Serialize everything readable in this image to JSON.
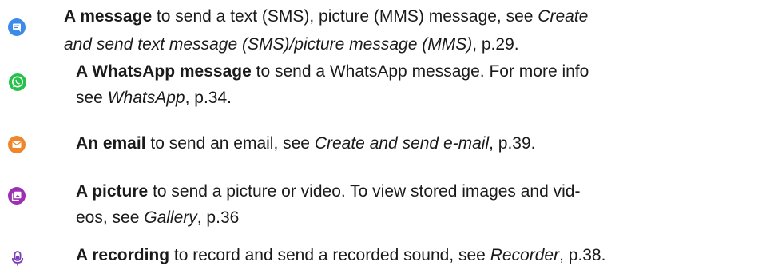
{
  "items": [
    {
      "icon": "message-icon",
      "icon_color": "#3d8be8",
      "title": "A message",
      "line1_rest": " to send a text (SMS), picture (MMS) message, see ",
      "line1_link": "Create",
      "line2_link": "and send text message (SMS)/picture message (MMS)",
      "line2_tail": ", p.29."
    },
    {
      "icon": "whatsapp-icon",
      "icon_color": "#27c04b",
      "title": "A WhatsApp message",
      "line1_rest": " to send a WhatsApp message. For more info",
      "line2_pre": "see ",
      "line2_link": "WhatsApp",
      "line2_tail": ", p.34."
    },
    {
      "icon": "email-icon",
      "icon_color": "#f0862a",
      "title": "An email",
      "line1_rest": " to send an email, see ",
      "line1_link": "Create and send e-mail",
      "line1_tail": ", p.39."
    },
    {
      "icon": "picture-icon",
      "icon_color": "#9b2fb5",
      "title": "A picture",
      "line1_rest": " to send a picture or video. To view stored images and vid-",
      "line2_pre": "eos, see ",
      "line2_link": "Gallery",
      "line2_tail": ", p.36"
    },
    {
      "icon": "microphone-icon",
      "icon_color": "#7a3fb8",
      "title": "A recording",
      "line1_rest": " to record and send a recorded sound, see ",
      "line1_link": "Recorder",
      "line1_tail": ", p.38."
    }
  ]
}
